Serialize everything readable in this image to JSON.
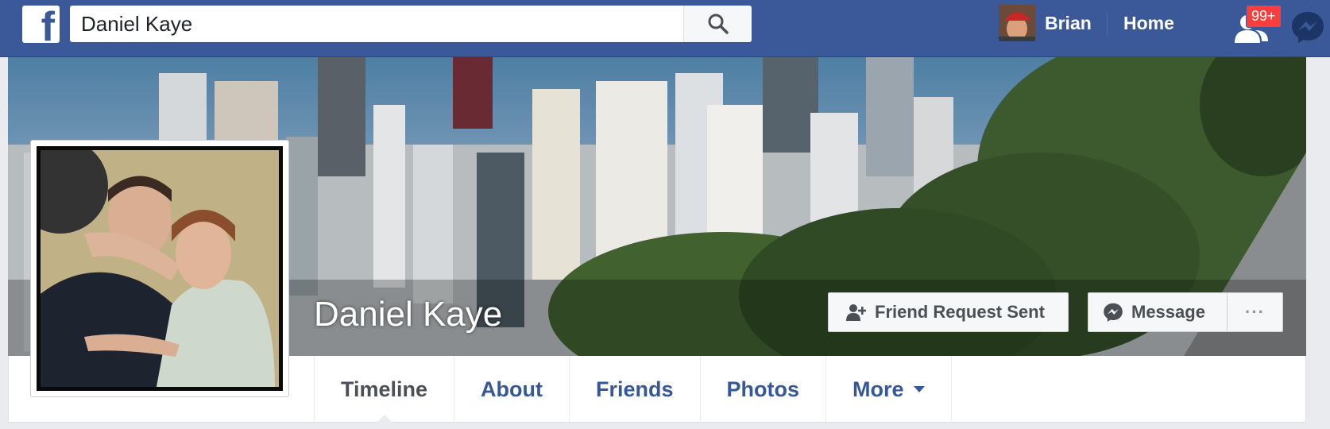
{
  "topbar": {
    "logo_letter": "f",
    "search_value": "Daniel Kaye",
    "user_name": "Brian",
    "home_label": "Home",
    "friend_requests_badge": "99+"
  },
  "profile": {
    "name": "Daniel Kaye",
    "friend_button": "Friend Request Sent",
    "message_button": "Message",
    "more_button": "···"
  },
  "tabs": [
    {
      "label": "Timeline",
      "active": true
    },
    {
      "label": "About"
    },
    {
      "label": "Friends"
    },
    {
      "label": "Photos"
    },
    {
      "label": "More"
    }
  ],
  "colors": {
    "brand": "#3b5998",
    "link": "#365899",
    "badge": "#fa3e3e"
  },
  "icons": [
    "search-icon",
    "friend-requests-icon",
    "messenger-icon",
    "add-friend-icon",
    "chevron-down-icon"
  ]
}
